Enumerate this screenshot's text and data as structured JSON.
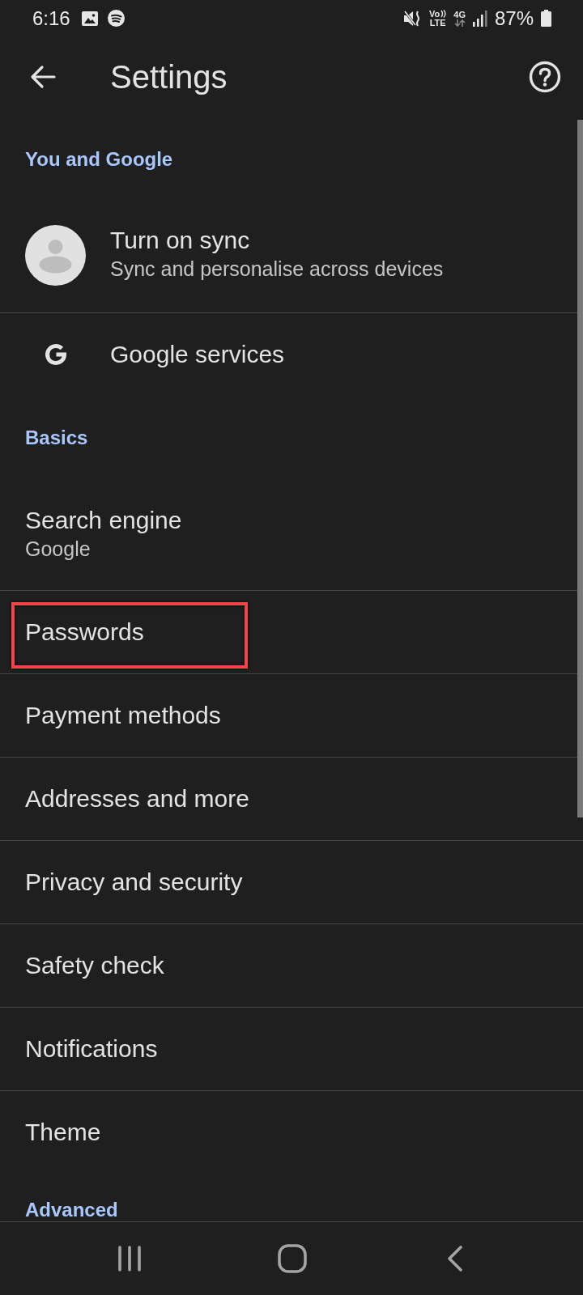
{
  "status_bar": {
    "time": "6:16",
    "volte_top": "Vo",
    "volte_bottom": "LTE",
    "network": "4G",
    "battery": "87%"
  },
  "app_bar": {
    "title": "Settings"
  },
  "sections": [
    {
      "heading": "You and Google",
      "items": [
        {
          "kind": "account",
          "title": "Turn on sync",
          "subtitle": "Sync and personalise across devices",
          "highlighted": false
        },
        {
          "kind": "service",
          "title": "Google services",
          "highlighted": false
        }
      ]
    },
    {
      "heading": "Basics",
      "items": [
        {
          "kind": "plain",
          "title": "Search engine",
          "subtitle": "Google",
          "highlighted": false
        },
        {
          "kind": "plain",
          "title": "Passwords",
          "highlighted": true
        },
        {
          "kind": "plain",
          "title": "Payment methods",
          "highlighted": false
        },
        {
          "kind": "plain",
          "title": "Addresses and more",
          "highlighted": false
        },
        {
          "kind": "plain",
          "title": "Privacy and security",
          "highlighted": false
        },
        {
          "kind": "plain",
          "title": "Safety check",
          "highlighted": false
        },
        {
          "kind": "plain",
          "title": "Notifications",
          "highlighted": false
        },
        {
          "kind": "plain",
          "title": "Theme",
          "highlighted": false
        }
      ]
    },
    {
      "heading": "Advanced"
    }
  ]
}
